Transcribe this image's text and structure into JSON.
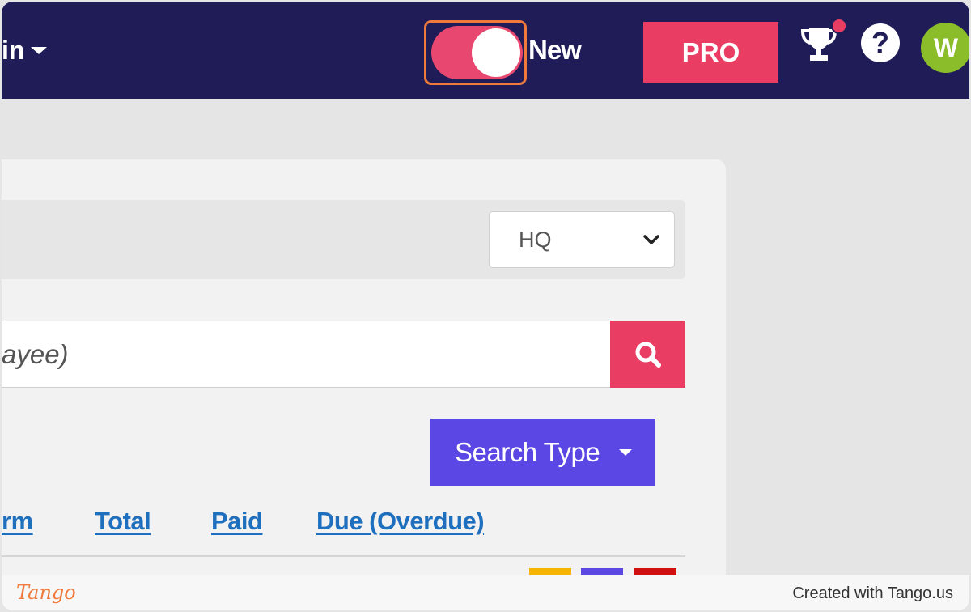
{
  "navbar": {
    "truncated_menu_label": "in",
    "toggle": {
      "label": "New",
      "state": "on",
      "accent_color": "#e8486f",
      "highlight_color": "#f07a3c"
    },
    "pro_label": "PRO",
    "pro_color": "#ea3d64",
    "avatar_initial": "W",
    "avatar_color": "#8bbd2b",
    "help_glyph": "?",
    "icons": [
      "chevron-down-icon",
      "trophy-icon",
      "notification-dot-icon",
      "help-icon"
    ],
    "background": "#201c57"
  },
  "filter": {
    "location_selected": "HQ"
  },
  "search": {
    "placeholder": "ayee)",
    "button_icon": "search-icon",
    "type_label": "Search Type"
  },
  "table": {
    "headers": [
      "rm",
      "Total",
      "Paid",
      "Due (Overdue)"
    ],
    "row_swatch_colors": [
      "#f4b400",
      "#5b47e4",
      "#d01010"
    ]
  },
  "footer": {
    "logo": "Tango",
    "credit": "Created with Tango.us"
  }
}
